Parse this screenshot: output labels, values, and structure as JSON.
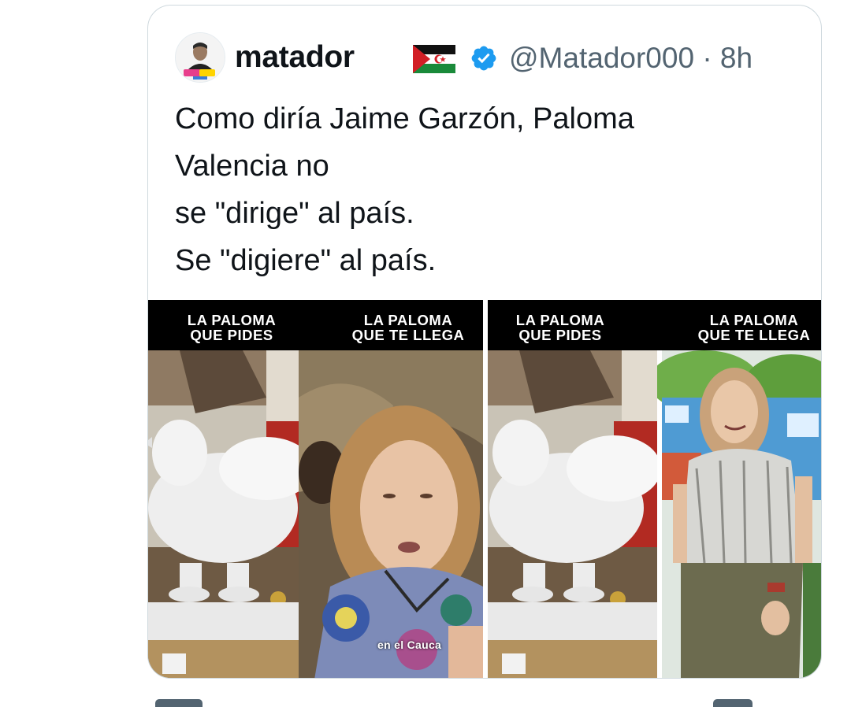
{
  "tweet": {
    "display_name": "matador",
    "handle": "@Matador000",
    "separator": "·",
    "time_ago": "8h",
    "flag_icon": "flag-icon",
    "verified_icon": "verified-badge-icon",
    "verified_color": "#1d9bf0",
    "text_lines": [
      "Como diría Jaime Garzón, Paloma",
      "Valencia no",
      "se \"dirige\" al país.",
      "Se \"digiere\" al país."
    ]
  },
  "media": [
    {
      "caption_left": "LA PALOMA\nQUE PIDES",
      "caption_right": "LA PALOMA\nQUE TE LLEGA",
      "overlay": "en el Cauca"
    },
    {
      "caption_left": "LA PALOMA\nQUE PIDES",
      "caption_right": "LA PALOMA\nQUE TE LLEGA"
    }
  ],
  "colors": {
    "border": "#cfd9de",
    "secondary_text": "#536471",
    "primary_text": "#0f1419"
  }
}
